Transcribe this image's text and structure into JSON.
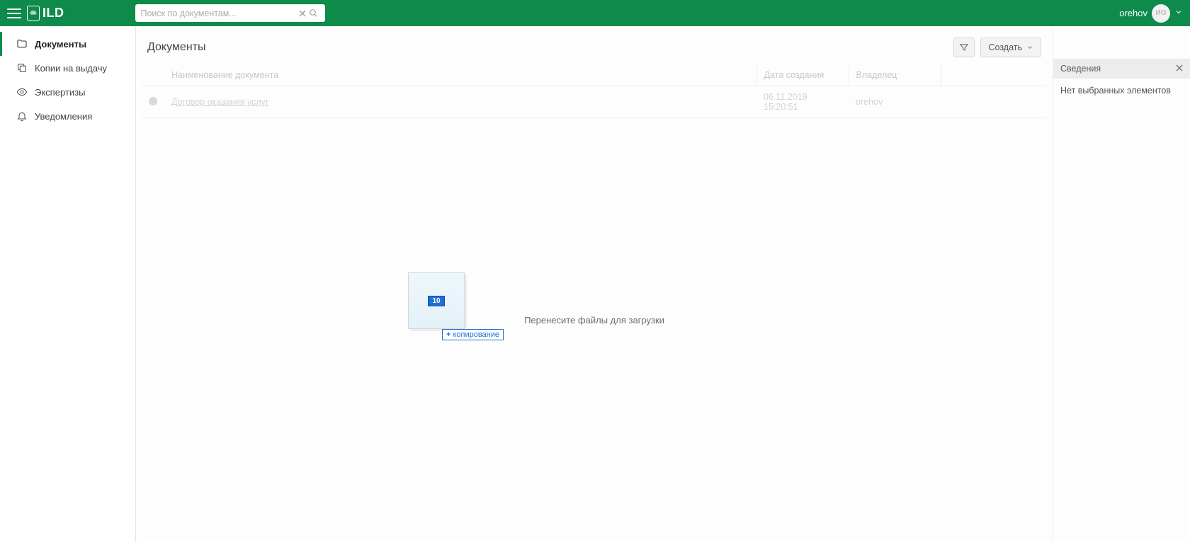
{
  "brand": {
    "name": "ILD"
  },
  "search": {
    "placeholder": "Поиск по документам..."
  },
  "user": {
    "name": "orehov",
    "initials": "ИО"
  },
  "sidebar": {
    "items": [
      {
        "label": "Документы"
      },
      {
        "label": "Копии на выдачу"
      },
      {
        "label": "Экспертизы"
      },
      {
        "label": "Уведомления"
      }
    ]
  },
  "page": {
    "title": "Документы"
  },
  "toolbar": {
    "create_label": "Создать"
  },
  "table": {
    "columns": {
      "name": "Наименование документа",
      "created": "Дата создания",
      "owner": "Владелец"
    },
    "rows": [
      {
        "name": "Договор оказания услуг",
        "created": "06.11.2019 15:20:51",
        "owner": "orehov"
      }
    ]
  },
  "dropzone": {
    "text": "Перенесите файлы для загрузки"
  },
  "drag": {
    "count": "10",
    "action": "копирование"
  },
  "details": {
    "title": "Сведения",
    "empty": "Нет выбранных элементов"
  }
}
